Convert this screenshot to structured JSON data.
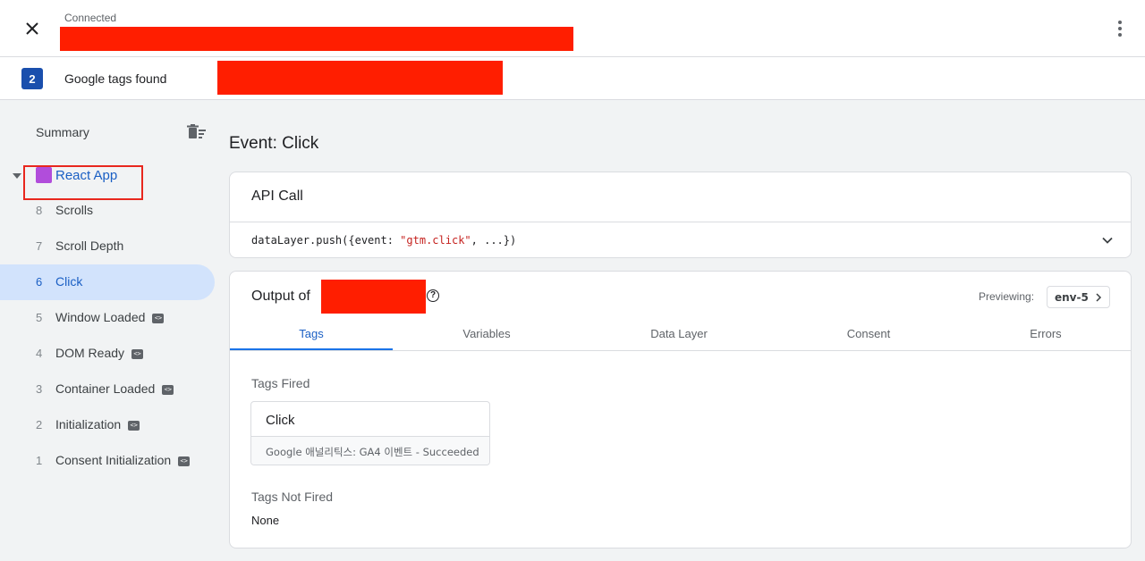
{
  "header": {
    "status": "Connected",
    "close_icon": "close-icon",
    "menu_icon": "more-vert-icon"
  },
  "tags_bar": {
    "count": "2",
    "label": "Google tags found"
  },
  "sidebar": {
    "summary_label": "Summary",
    "delete_icon": "delete-sweep-icon",
    "app": {
      "name": "React App",
      "color": "#b14ddb"
    },
    "events": [
      {
        "num": "8",
        "label": "Scrolls",
        "has_code_badge": false
      },
      {
        "num": "7",
        "label": "Scroll Depth",
        "has_code_badge": false
      },
      {
        "num": "6",
        "label": "Click",
        "has_code_badge": false,
        "selected": true
      },
      {
        "num": "5",
        "label": "Window Loaded",
        "has_code_badge": true
      },
      {
        "num": "4",
        "label": "DOM Ready",
        "has_code_badge": true
      },
      {
        "num": "3",
        "label": "Container Loaded",
        "has_code_badge": true
      },
      {
        "num": "2",
        "label": "Initialization",
        "has_code_badge": true
      },
      {
        "num": "1",
        "label": "Consent Initialization",
        "has_code_badge": true
      }
    ]
  },
  "main": {
    "title": "Event: Click",
    "api_call": {
      "title": "API Call",
      "code_prefix": "dataLayer.push({event: ",
      "code_string": "\"gtm.click\"",
      "code_suffix": ", ...})"
    },
    "output": {
      "title": "Output of ",
      "previewing_label": "Previewing:",
      "env": "env-5",
      "tabs": [
        "Tags",
        "Variables",
        "Data Layer",
        "Consent",
        "Errors"
      ],
      "active_tab": "Tags",
      "tags_fired_label": "Tags Fired",
      "fired_tags": [
        {
          "name": "Click",
          "detail": "Google 애널리틱스: GA4 이벤트 - Succeeded"
        }
      ],
      "tags_not_fired_label": "Tags Not Fired",
      "not_fired_text": "None"
    }
  },
  "colors": {
    "accent": "#1a73e8",
    "badge": "#1a4fad",
    "selected_bg": "#d2e3fc",
    "redaction": "#ff1e00",
    "highlight": "#e8271e"
  }
}
